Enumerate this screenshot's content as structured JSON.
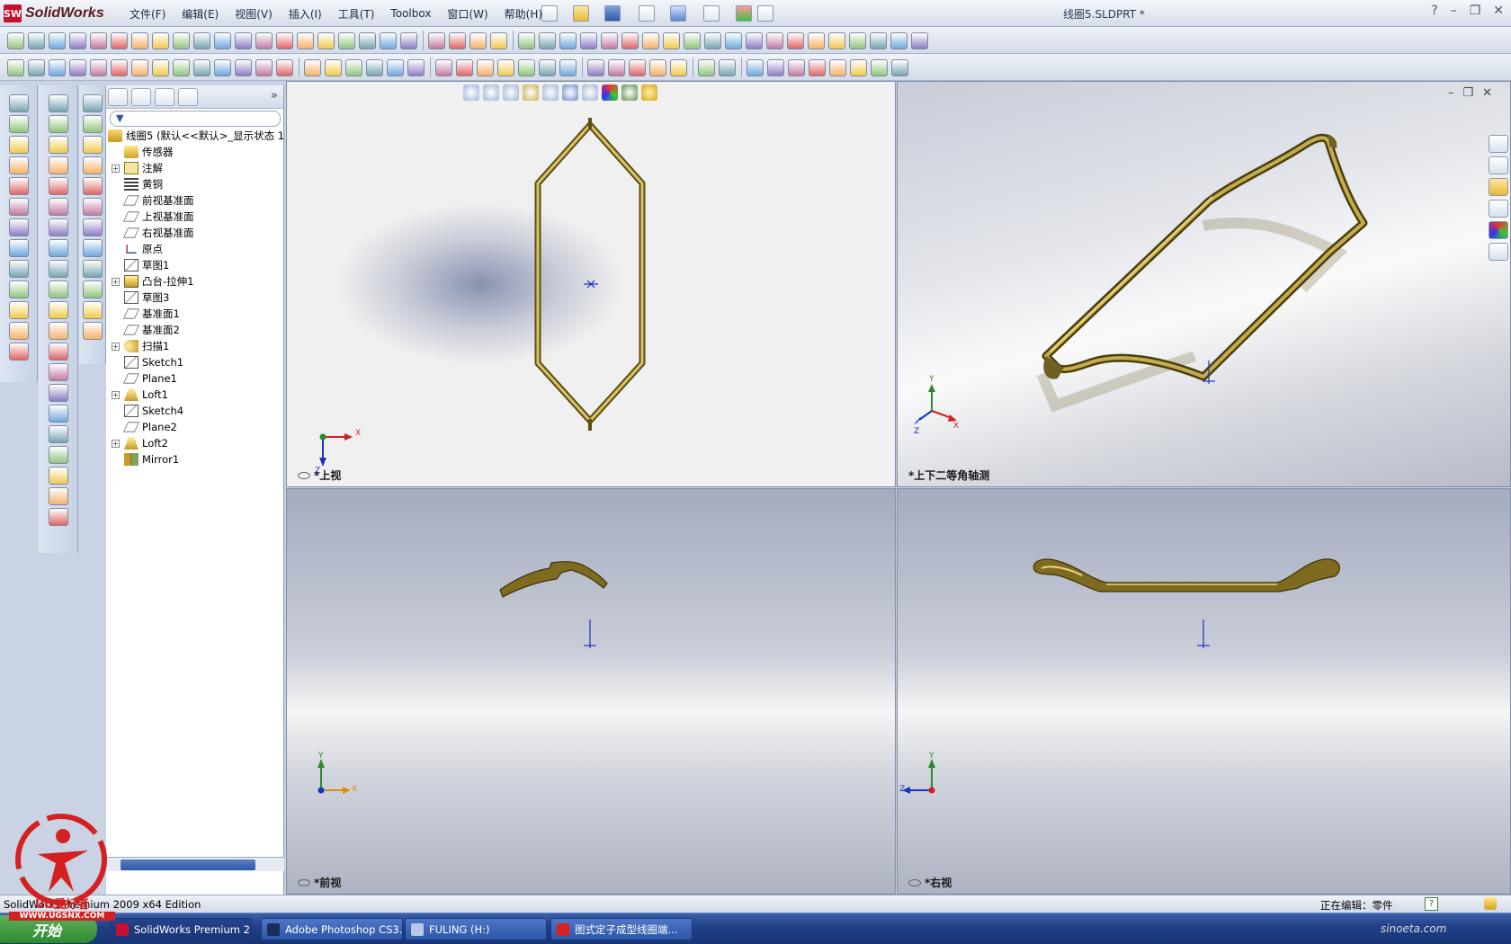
{
  "app": {
    "logo_text": "SolidWorks",
    "logo_mark": "SW",
    "doc_title": "线圈5.SLDPRT *"
  },
  "menu": [
    "文件(F)",
    "编辑(E)",
    "视图(V)",
    "插入(I)",
    "工具(T)",
    "Toolbox",
    "窗口(W)",
    "帮助(H)"
  ],
  "window_controls": [
    "?",
    "–",
    "❐",
    "✕"
  ],
  "tree": {
    "root": "线圈5  (默认<<默认>_显示状态 1",
    "items": [
      {
        "label": "传感器",
        "icon": "sensor-icon",
        "expandable": false
      },
      {
        "label": "注解",
        "icon": "annotation-icon",
        "expandable": true
      },
      {
        "label": "黄铜",
        "icon": "material-icon",
        "expandable": false
      },
      {
        "label": "前视基准面",
        "icon": "plane-icon",
        "expandable": false
      },
      {
        "label": "上视基准面",
        "icon": "plane-icon",
        "expandable": false
      },
      {
        "label": "右视基准面",
        "icon": "plane-icon",
        "expandable": false
      },
      {
        "label": "原点",
        "icon": "origin-icon",
        "expandable": false
      },
      {
        "label": "草图1",
        "icon": "sketch-icon",
        "expandable": false
      },
      {
        "label": "凸台-拉伸1",
        "icon": "extrude-icon",
        "expandable": true
      },
      {
        "label": "草图3",
        "icon": "sketch-icon",
        "expandable": false
      },
      {
        "label": "基准面1",
        "icon": "plane-icon",
        "expandable": false
      },
      {
        "label": "基准面2",
        "icon": "plane-icon",
        "expandable": false
      },
      {
        "label": "扫描1",
        "icon": "sweep-icon",
        "expandable": true
      },
      {
        "label": "Sketch1",
        "icon": "sketch-icon",
        "expandable": false
      },
      {
        "label": "Plane1",
        "icon": "plane-icon",
        "expandable": false
      },
      {
        "label": "Loft1",
        "icon": "loft-icon",
        "expandable": true
      },
      {
        "label": "Sketch4",
        "icon": "sketch-icon",
        "expandable": false
      },
      {
        "label": "Plane2",
        "icon": "plane-icon",
        "expandable": false
      },
      {
        "label": "Loft2",
        "icon": "loft-icon",
        "expandable": true
      },
      {
        "label": "Mirror1",
        "icon": "mirror-icon",
        "expandable": false
      }
    ]
  },
  "viewports": {
    "top": "*上视",
    "iso": "*上下二等角轴测",
    "front": "*前视",
    "right": "*右视"
  },
  "axes": {
    "x": "X",
    "y": "Y",
    "z": "Z"
  },
  "status": {
    "left": "SolidWorks Premium 2009 x64 Edition",
    "right": "正在编辑：零件",
    "help": "?"
  },
  "taskbar": {
    "start": "开始",
    "tasks": [
      "SolidWorks Premium 2...",
      "Adobe Photoshop CS3...",
      "FULING (H:)",
      "图式定子成型线圈端..."
    ]
  },
  "watermark": {
    "text": "UG爱好者",
    "url": "WWW.UGSNX.COM",
    "corner": "sinoeta.com"
  },
  "colors": {
    "model": "#8a7424",
    "model_light": "#d8c468",
    "accent": "#2f5aa8"
  }
}
